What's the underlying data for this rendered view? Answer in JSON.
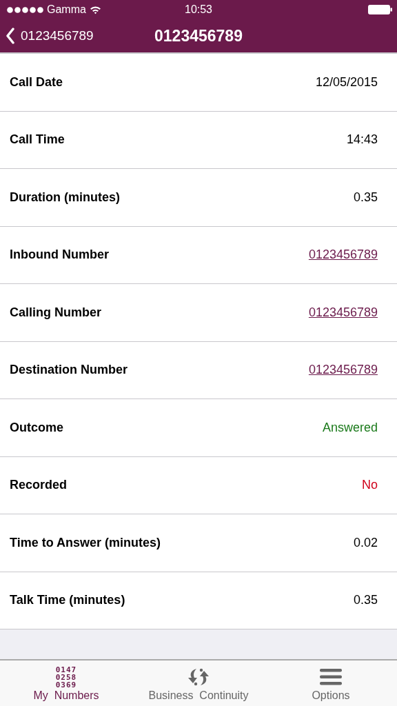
{
  "status_bar": {
    "carrier": "Gamma",
    "time": "10:53"
  },
  "nav": {
    "back_label": "0123456789",
    "title": "0123456789"
  },
  "rows": [
    {
      "label": "Call Date",
      "value": "12/05/2015",
      "kind": "plain"
    },
    {
      "label": "Call Time",
      "value": "14:43",
      "kind": "plain"
    },
    {
      "label": "Duration (minutes)",
      "value": "0.35",
      "kind": "plain"
    },
    {
      "label": "Inbound Number",
      "value": "0123456789",
      "kind": "link"
    },
    {
      "label": "Calling Number",
      "value": "0123456789",
      "kind": "link"
    },
    {
      "label": "Destination Number",
      "value": "0123456789",
      "kind": "link"
    },
    {
      "label": "Outcome",
      "value": "Answered",
      "kind": "success"
    },
    {
      "label": "Recorded",
      "value": "No",
      "kind": "error"
    },
    {
      "label": "Time to Answer (minutes)",
      "value": "0.02",
      "kind": "plain"
    },
    {
      "label": "Talk Time (minutes)",
      "value": "0.35",
      "kind": "plain"
    }
  ],
  "tabs": [
    {
      "label": "My  Numbers",
      "kind": "digits",
      "digits": [
        "0147",
        "0258",
        "0369"
      ],
      "selected": true
    },
    {
      "label": "Business  Continuity",
      "kind": "arrows",
      "selected": false
    },
    {
      "label": "Options",
      "kind": "menu",
      "selected": false
    }
  ]
}
